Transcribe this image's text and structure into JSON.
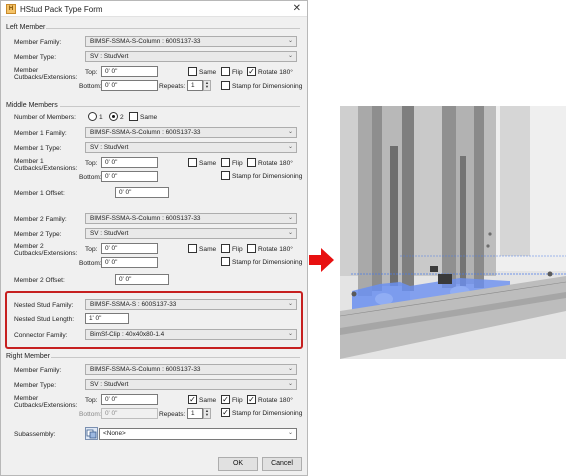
{
  "dialog": {
    "title": "HStud Pack Type Form",
    "icon_name": "app-icon",
    "close_glyph": "✕",
    "left_member": {
      "section": "Left Member",
      "family_label": "Member Family:",
      "family_value": "BIMSF-SSMA-S-Column : 600S137-33",
      "type_label": "Member Type:",
      "type_value": "SV : StudVert",
      "cutbacks_label_1": "Member",
      "cutbacks_label_2": "Cutbacks/Extensions:",
      "top_label": "Top:",
      "top_value": "0'  0\"",
      "bottom_label": "Bottom:",
      "bottom_value": "0'  0\"",
      "same_label": "Same",
      "flip_label": "Flip",
      "rotate_label": "Rotate 180°",
      "rotate_checked": "✓",
      "repeats_label": "Repeats:",
      "repeats_value": "1",
      "stamp_label": "Stamp for Dimensioning"
    },
    "middle_members": {
      "section": "Middle Members",
      "number_label": "Number of Members:",
      "opt1": "1",
      "opt2": "2",
      "same_label": "Same",
      "m1_family_label": "Member 1 Family:",
      "m1_family_value": "BIMSF-SSMA-S-Column : 600S137-33",
      "m1_type_label": "Member 1 Type:",
      "m1_type_value": "SV : StudVert",
      "m1_cut_label_1": "Member 1",
      "m1_cut_label_2": "Cutbacks/Extensions:",
      "m1_top_label": "Top:",
      "m1_top_value": "0'  0\"",
      "m1_bottom_label": "Bottom:",
      "m1_bottom_value": "0'  0\"",
      "m1_same_label": "Same",
      "m1_flip_label": "Flip",
      "m1_rotate_label": "Rotate 180°",
      "m1_stamp_label": "Stamp for Dimensioning",
      "m1_offset_label": "Member 1 Offset:",
      "m1_offset_value": "0'  0\"",
      "m2_family_label": "Member 2 Family:",
      "m2_family_value": "BIMSF-SSMA-S-Column : 600S137-33",
      "m2_type_label": "Member 2 Type:",
      "m2_type_value": "SV : StudVert",
      "m2_cut_label_1": "Member 2",
      "m2_cut_label_2": "Cutbacks/Extensions:",
      "m2_top_label": "Top:",
      "m2_top_value": "0'  0\"",
      "m2_bottom_label": "Bottom:",
      "m2_bottom_value": "0'  0\"",
      "m2_same_label": "Same",
      "m2_flip_label": "Flip",
      "m2_rotate_label": "Rotate 180°",
      "m2_stamp_label": "Stamp for Dimensioning",
      "m2_offset_label": "Member 2 Offset:",
      "m2_offset_value": "0'  0\""
    },
    "nested": {
      "family_label": "Nested Stud Family:",
      "family_value": "BIMSF-SSMA-S : 600S137-33",
      "length_label": "Nested Stud Length:",
      "length_value": "1'  0\"",
      "connector_label": "Connector Family:",
      "connector_value": "BimSf-Clip : 40x40x80-1.4"
    },
    "right_member": {
      "section": "Right Member",
      "family_label": "Member Family:",
      "family_value": "BIMSF-SSMA-S-Column : 600S137-33",
      "type_label": "Member Type:",
      "type_value": "SV : StudVert",
      "cutbacks_label_1": "Member",
      "cutbacks_label_2": "Cutbacks/Extensions:",
      "top_label": "Top:",
      "top_value": "0'  0\"",
      "bottom_label": "Bottom:",
      "bottom_value": "0'  0\"",
      "same_label": "Same",
      "flip_label": "Flip",
      "rotate_label": "Rotate 180°",
      "repeats_label": "Repeats:",
      "repeats_value": "1",
      "stamp_label": "Stamp for Dimensioning",
      "check": "✓"
    },
    "subassembly": {
      "label": "Subassembly:",
      "value": "<None>",
      "icon_name": "subassembly-icon"
    },
    "ok_label": "OK",
    "cancel_label": "Cancel"
  },
  "colors": {
    "highlight_border": "#c62020",
    "arrow": "#e81010",
    "selection": "#4a7be8"
  }
}
